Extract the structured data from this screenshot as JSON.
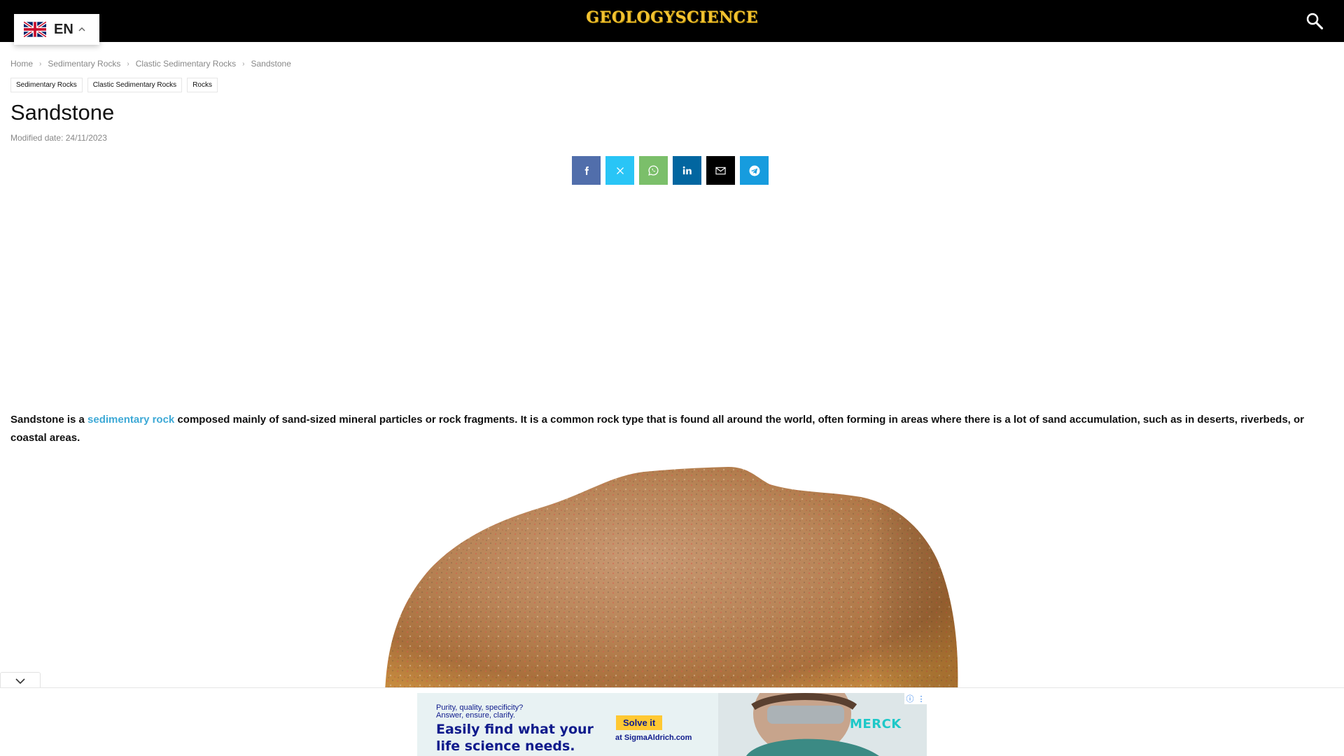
{
  "header": {
    "logo": "GEOLOGYSCIENCE",
    "search_icon": "search-icon"
  },
  "language": {
    "code": "EN",
    "flag_icon": "uk-flag-icon",
    "caret_icon": "chevron-up-icon"
  },
  "breadcrumb": {
    "items": [
      "Home",
      "Sedimentary Rocks",
      "Clastic Sedimentary Rocks",
      "Sandstone"
    ]
  },
  "tags": [
    "Sedimentary Rocks",
    "Clastic Sedimentary Rocks",
    "Rocks"
  ],
  "article": {
    "title": "Sandstone",
    "modified": "Modified date: 24/11/2023",
    "lead_before": "Sandstone is a ",
    "lead_link": "sedimentary rock",
    "lead_after": " composed mainly of sand-sized mineral particles or rock fragments. It is a common rock type that is found all around the world, often forming in areas where there is a lot of sand accumulation, such as in deserts, riverbeds, or coastal areas."
  },
  "share": [
    {
      "icon": "facebook-icon",
      "color": "#516eab"
    },
    {
      "icon": "x-twitter-icon",
      "color": "#29c5f6"
    },
    {
      "icon": "whatsapp-icon",
      "color": "#7bbf6a"
    },
    {
      "icon": "linkedin-icon",
      "color": "#0266a0"
    },
    {
      "icon": "email-icon",
      "color": "#000000"
    },
    {
      "icon": "telegram-icon",
      "color": "#179cde"
    }
  ],
  "ad": {
    "line1": "Purity, quality, specificity?",
    "line2": "Answer, ensure, clarify.",
    "headline1": "Easily find what your",
    "headline2": "life science needs.",
    "cta": "Solve it",
    "cta_sub": "at SigmaAldrich.com",
    "brand": "MERCK",
    "toggle_icon": "chevron-down-icon"
  },
  "colors": {
    "link": "#3da9d6",
    "logo": "#f2c230",
    "ad_text": "#0f1b8c"
  }
}
